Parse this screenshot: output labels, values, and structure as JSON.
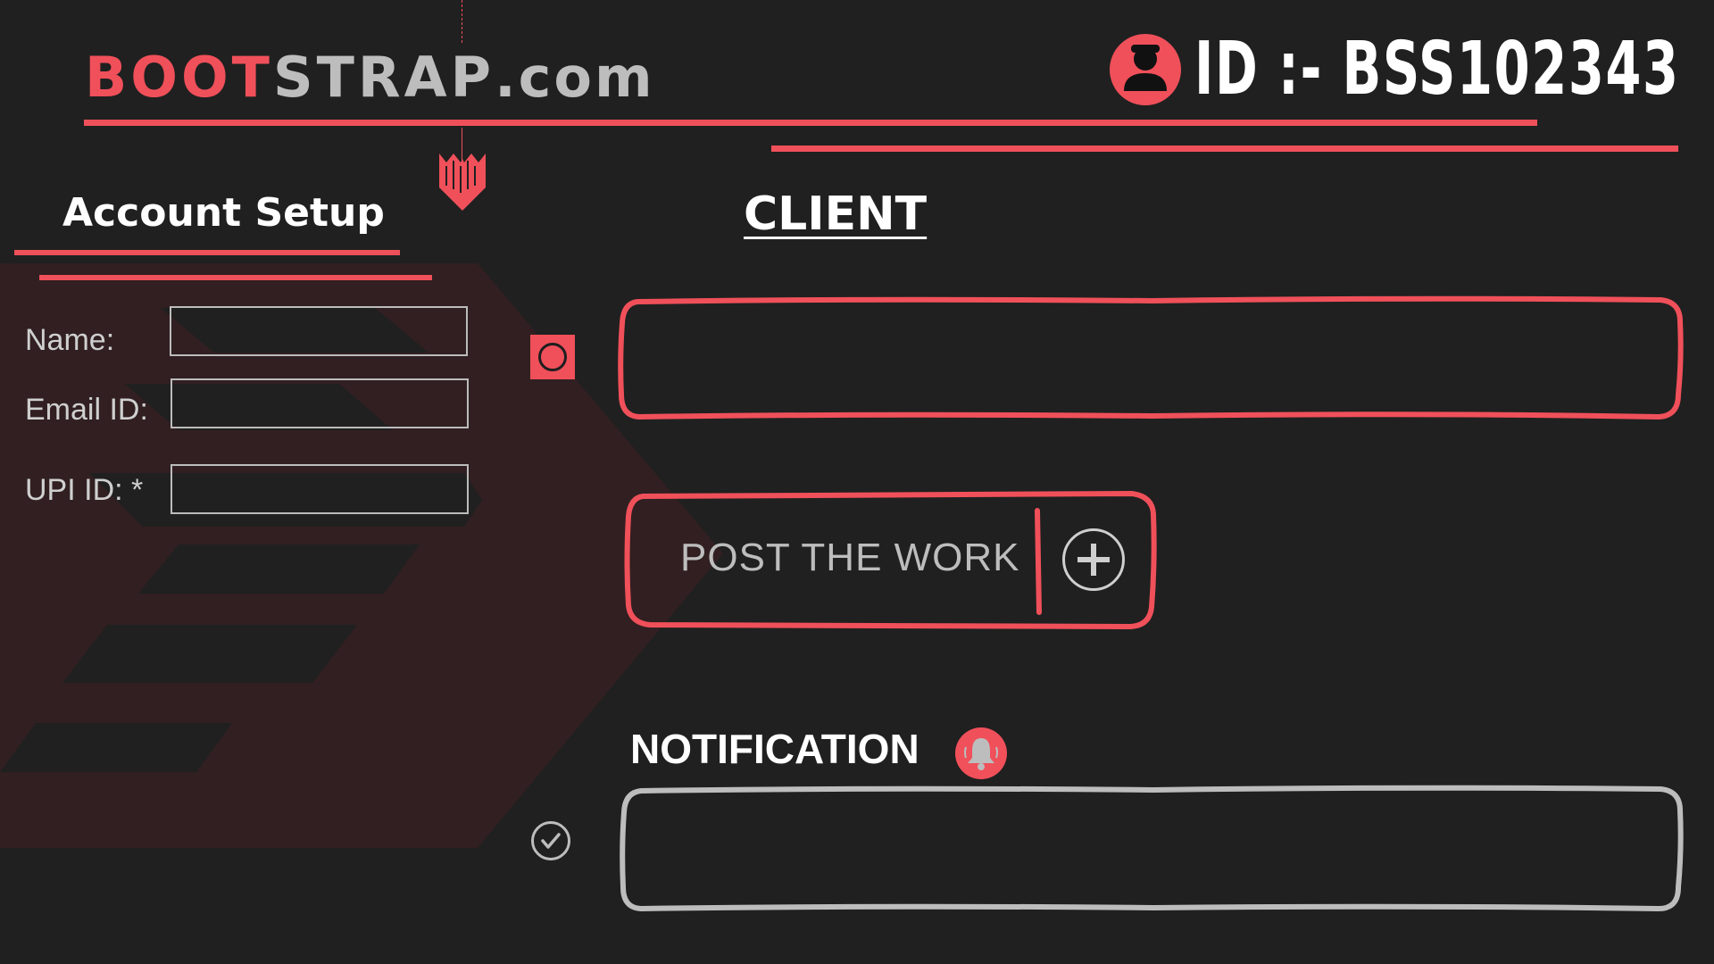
{
  "brand": {
    "part1": "BOOT",
    "part2": "STRAP",
    "part3": ".com"
  },
  "user": {
    "id_label": "ID :- BSS102343",
    "icon": "user-icon"
  },
  "account": {
    "title": "Account Setup",
    "fields": [
      {
        "label": "Name:",
        "value": ""
      },
      {
        "label": "Email ID:",
        "value": ""
      },
      {
        "label": "UPI ID: *",
        "value": ""
      }
    ]
  },
  "client": {
    "title": "CLIENT",
    "input_value": ""
  },
  "post": {
    "label": "POST THE WORK",
    "icon": "plus-circle-icon"
  },
  "notification": {
    "title": "NOTIFICATION",
    "icon": "bell-icon",
    "content": ""
  },
  "colors": {
    "accent": "#f0505a",
    "background": "#202020",
    "muted": "#bdbdbd"
  }
}
